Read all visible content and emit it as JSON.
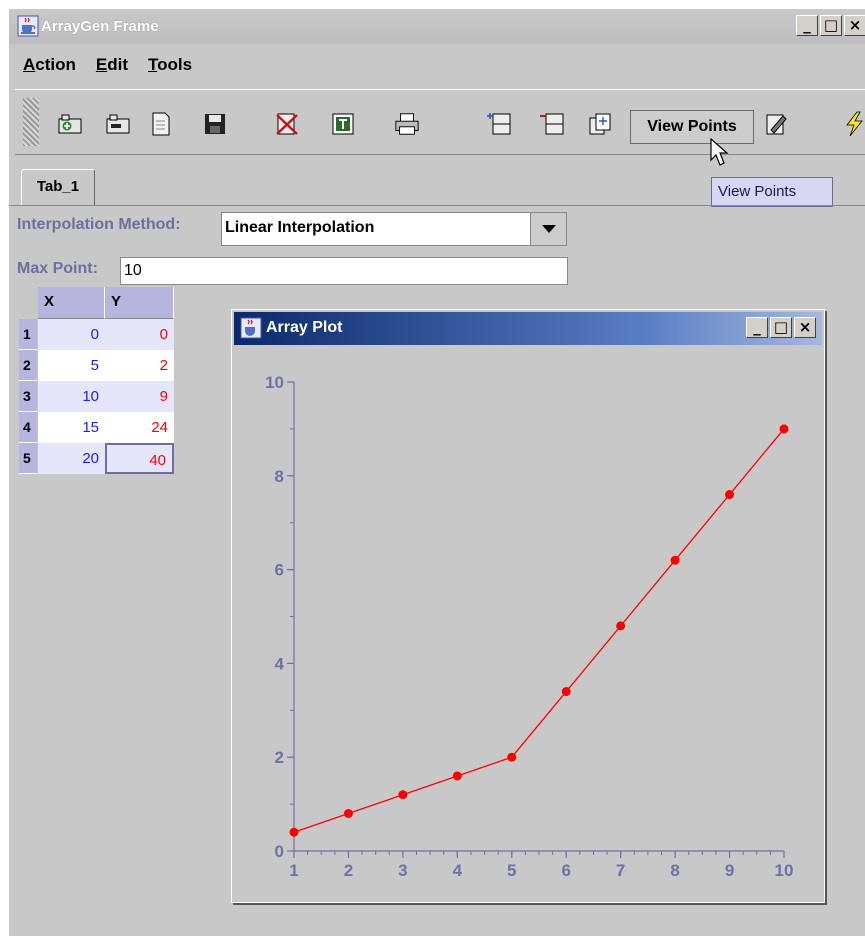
{
  "window": {
    "title": "ArrayGen Frame",
    "icon": "java-cup-icon"
  },
  "menubar": {
    "items": [
      {
        "label": "Action",
        "mnemonic": "A",
        "rest": "ction"
      },
      {
        "label": "Edit",
        "mnemonic": "E",
        "rest": "dit"
      },
      {
        "label": "Tools",
        "mnemonic": "T",
        "rest": "ools"
      }
    ]
  },
  "toolbar": {
    "icons": [
      "add-tab-icon",
      "remove-tab-icon",
      "new-document-icon",
      "save-icon",
      "delete-icon",
      "table-icon",
      "print-icon",
      "insert-row-icon",
      "delete-row-icon",
      "copy-icon",
      "edit-icon",
      "lightning-icon"
    ],
    "view_points_label": "View Points",
    "tooltip": "View Points"
  },
  "tabs": [
    {
      "label": "Tab_1"
    }
  ],
  "form": {
    "interpolation_label": "Interpolation Method:",
    "interpolation_value": "Linear Interpolation",
    "max_point_label": "Max Point:",
    "max_point_value": "10"
  },
  "table": {
    "columns": [
      "X",
      "Y"
    ],
    "rows": [
      {
        "index": "1",
        "x": "0",
        "y": "0"
      },
      {
        "index": "2",
        "x": "5",
        "y": "2"
      },
      {
        "index": "3",
        "x": "10",
        "y": "9"
      },
      {
        "index": "4",
        "x": "15",
        "y": "24"
      },
      {
        "index": "5",
        "x": "20",
        "y": "40"
      }
    ],
    "colors": {
      "x": "#1a1aff",
      "y": "#ff0000",
      "header": "#b5b5e0"
    }
  },
  "plot_window": {
    "title": "Array Plot"
  },
  "chart_data": {
    "type": "line",
    "x": [
      1,
      2,
      3,
      4,
      5,
      6,
      7,
      8,
      9,
      10
    ],
    "y": [
      0.4,
      0.8,
      1.2,
      1.6,
      2.0,
      3.4,
      4.8,
      6.2,
      7.6,
      9.0
    ],
    "xlim": [
      1,
      10
    ],
    "ylim": [
      0,
      10
    ],
    "xticks": [
      "1",
      "2",
      "3",
      "4",
      "5",
      "6",
      "7",
      "8",
      "9",
      "10"
    ],
    "yticks": [
      "0",
      "2",
      "4",
      "6",
      "8",
      "10"
    ],
    "grid": false,
    "line_color": "#ff0000",
    "axis_color": "#7070a8"
  }
}
